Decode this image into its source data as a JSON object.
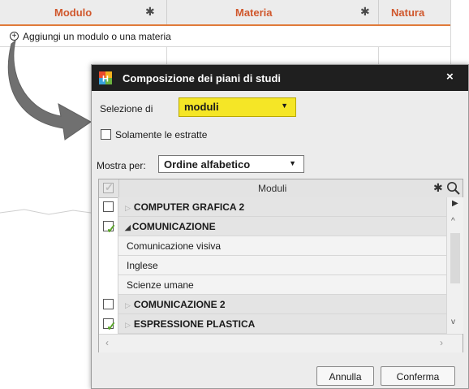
{
  "background": {
    "columns": [
      "Modulo",
      "Materia",
      "Natura"
    ],
    "add_action": "Aggiungi un modulo o una materia"
  },
  "dialog": {
    "title": "Composizione dei piani di studi",
    "close_glyph": "×",
    "selection_label": "Selezione di",
    "selection_value": "moduli",
    "only_extracted_label": "Solamente le estratte",
    "show_by_label": "Mostra per:",
    "show_by_value": "Ordine alfabetico",
    "grid_header": "Moduli",
    "rows": [
      {
        "kind": "group",
        "label": "COMPUTER GRAFICA 2",
        "expanded": false,
        "checked": false
      },
      {
        "kind": "group",
        "label": "COMUNICAZIONE",
        "expanded": true,
        "checked": true
      },
      {
        "kind": "child",
        "label": "Comunicazione visiva"
      },
      {
        "kind": "child",
        "label": "Inglese"
      },
      {
        "kind": "child",
        "label": "Scienze umane"
      },
      {
        "kind": "group",
        "label": "COMUNICAZIONE 2",
        "expanded": false,
        "checked": false
      },
      {
        "kind": "group",
        "label": "ESPRESSIONE PLASTICA",
        "expanded": false,
        "checked": true
      }
    ],
    "cancel_label": "Annulla",
    "confirm_label": "Conferma"
  },
  "colors": {
    "accent_orange": "#d0572c",
    "highlight_yellow": "#f5e626",
    "title_bar": "#1f1f1f",
    "check_green": "#5aa628",
    "callout_arrow": "#8a1a1a"
  },
  "icons": [
    "gear-icon",
    "add-circle-icon",
    "app-logo-icon",
    "close-icon",
    "search-icon",
    "play-icon",
    "chevron-up-icon",
    "chevron-down-icon"
  ]
}
